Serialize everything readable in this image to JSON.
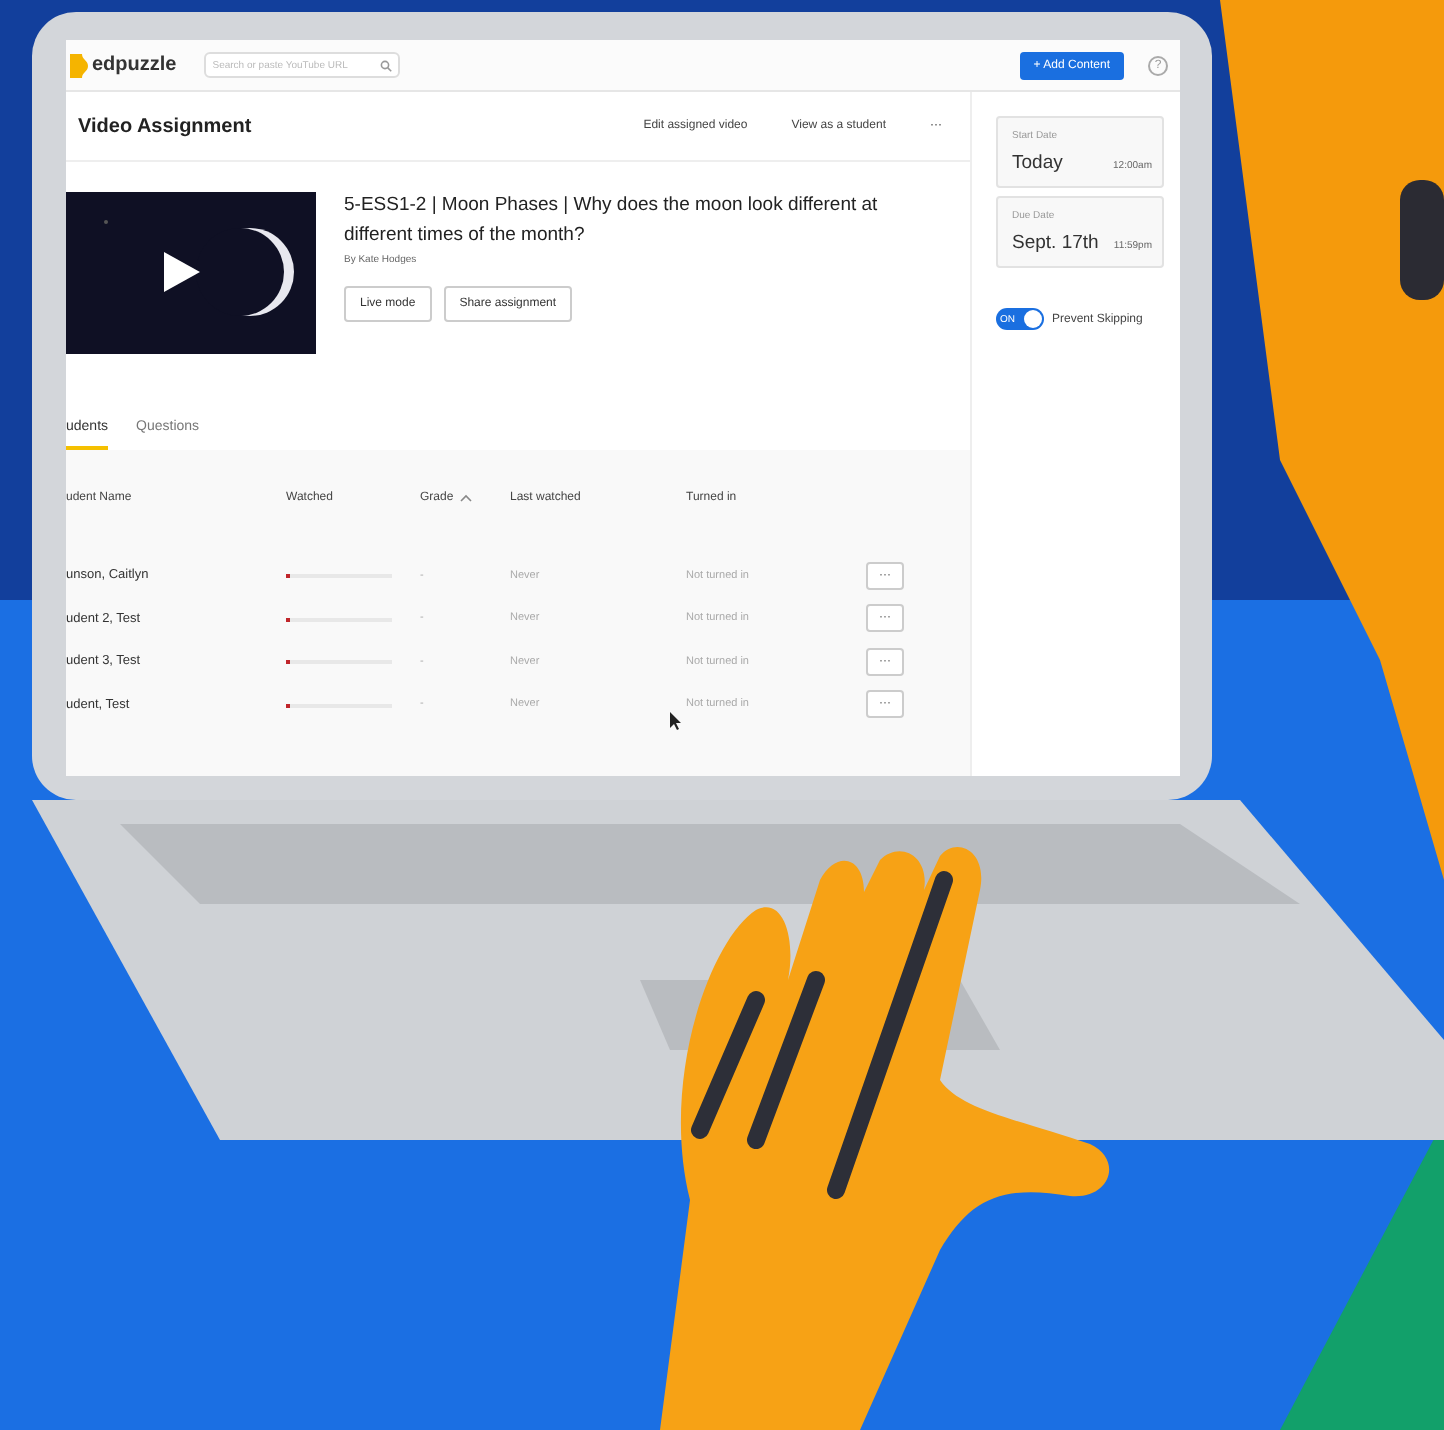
{
  "header": {
    "logo": "edpuzzle",
    "search": {
      "placeholder": "Search or paste YouTube URL"
    },
    "add_button": "+ Add Content",
    "help": "?"
  },
  "page": {
    "title": "Video Assignment",
    "actions": [
      "Edit assigned video",
      "View as a student",
      "···"
    ]
  },
  "video": {
    "title": "5-ESS1-2 | Moon Phases | Why does the moon look different at different times of the month?",
    "author": "By Kate Hodges",
    "buttons": [
      "Live mode",
      "Share assignment"
    ]
  },
  "tabs": [
    {
      "label": "udents",
      "selected": true
    },
    {
      "label": "Questions",
      "selected": false
    }
  ],
  "table": {
    "columns": [
      "udent Name",
      "Watched",
      "Grade",
      "Last watched",
      "Turned in"
    ],
    "rows": [
      {
        "name": "unson, Caitlyn",
        "level": 0.03,
        "grade": "-",
        "last": "Never",
        "turned": "Not turned in",
        "menu": "···"
      },
      {
        "name": "udent 2, Test",
        "level": 0.03,
        "grade": "-",
        "last": "Never",
        "turned": "Not turned in",
        "menu": "···"
      },
      {
        "name": "udent 3, Test",
        "level": 0.03,
        "grade": "-",
        "last": "Never",
        "turned": "Not turned in",
        "menu": "···"
      },
      {
        "name": "udent, Test",
        "level": 0.03,
        "grade": "-",
        "last": "Never",
        "turned": "Not turned in",
        "menu": "···"
      }
    ]
  },
  "dates": [
    {
      "label": "Start Date",
      "date": "Today",
      "time": "12:00am"
    },
    {
      "label": "Due Date",
      "date": "Sept. 17th",
      "time": "11:59pm"
    }
  ],
  "toggle": {
    "on": true,
    "text": "ON",
    "label": "Prevent Skipping"
  }
}
